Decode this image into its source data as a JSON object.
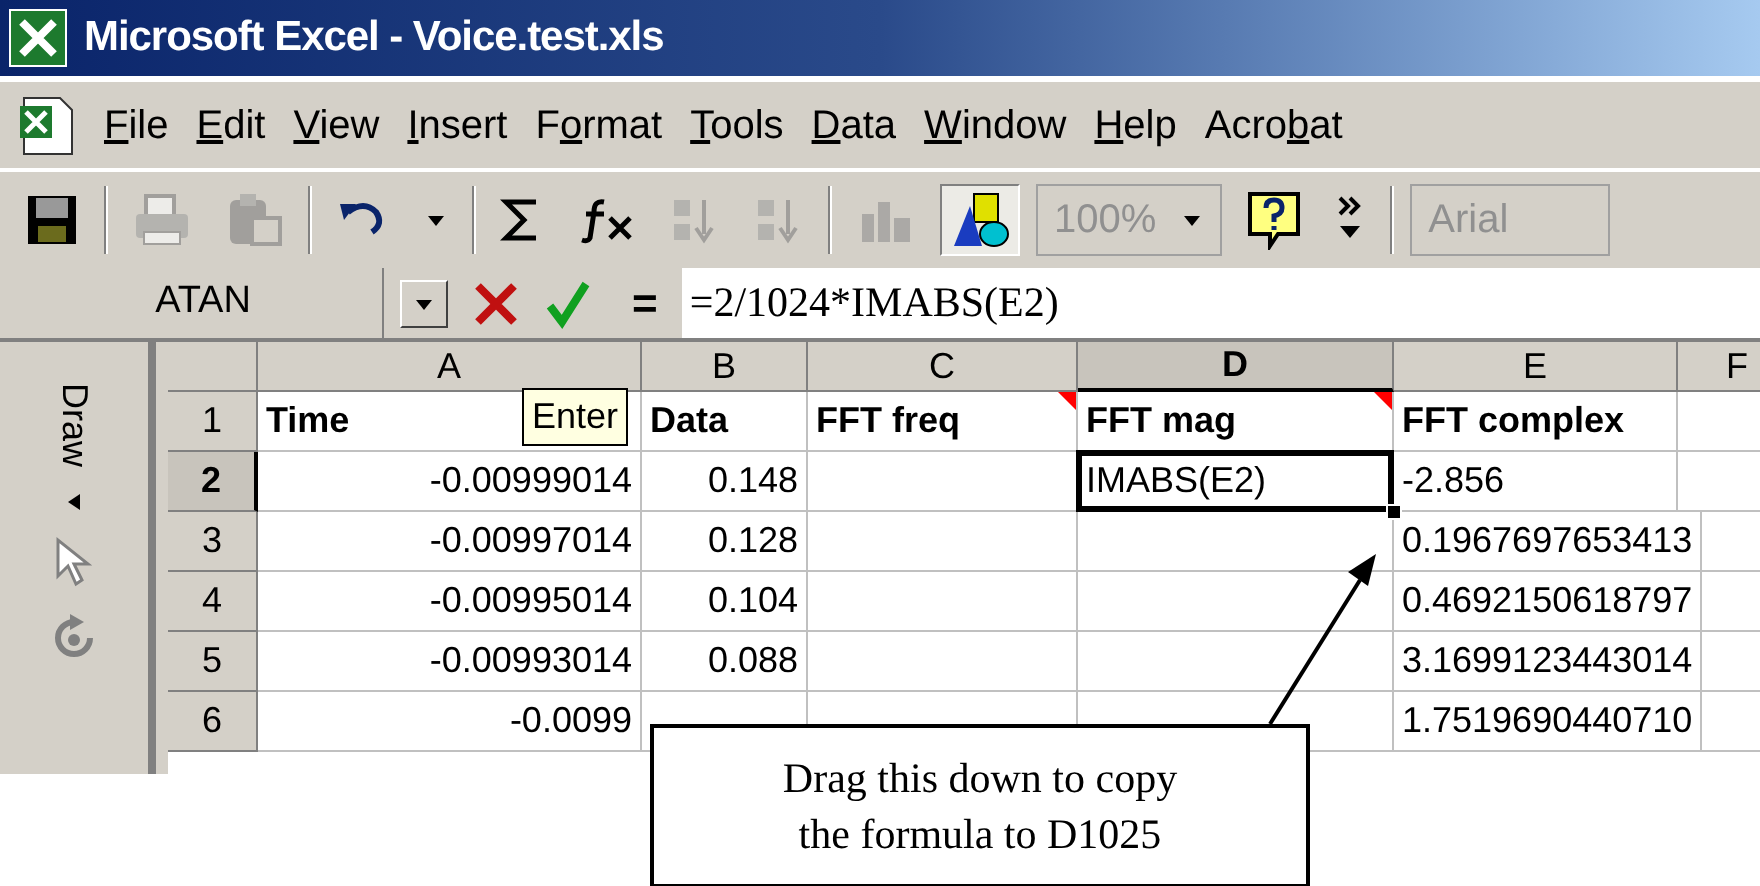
{
  "window": {
    "title": "Microsoft Excel - Voice.test.xls"
  },
  "menu_bar": {
    "items": [
      {
        "key": "F",
        "rest": "ile"
      },
      {
        "key": "E",
        "rest": "dit"
      },
      {
        "key": "V",
        "rest": "iew"
      },
      {
        "key": "I",
        "rest": "nsert"
      },
      {
        "pre": "F",
        "key": "o",
        "rest": "rmat"
      },
      {
        "key": "T",
        "rest": "ools"
      },
      {
        "key": "D",
        "rest": "ata"
      },
      {
        "key": "W",
        "rest": "indow"
      },
      {
        "key": "H",
        "rest": "elp"
      },
      {
        "pre": "Acro",
        "key": "b",
        "rest": "at"
      }
    ]
  },
  "toolbar": {
    "groups": [
      [
        {
          "kind": "save",
          "disabled": false
        }
      ],
      [
        {
          "kind": "print",
          "disabled": true
        },
        {
          "kind": "paste",
          "disabled": true
        }
      ],
      [
        {
          "kind": "undo",
          "disabled": false
        },
        {
          "kind": "dropdown",
          "disabled": false
        }
      ],
      [
        {
          "kind": "sum",
          "disabled": false
        },
        {
          "kind": "function",
          "disabled": false
        },
        {
          "kind": "sortup",
          "disabled": true
        },
        {
          "kind": "sortdown",
          "disabled": true
        }
      ],
      [
        {
          "kind": "chart",
          "disabled": true
        },
        {
          "kind": "drawing",
          "disabled": false,
          "pressed": true
        },
        {
          "kind": "zoom",
          "value": "100%",
          "disabled": true
        },
        {
          "kind": "help",
          "disabled": false
        },
        {
          "kind": "more",
          "disabled": false
        }
      ],
      [
        {
          "kind": "font",
          "value": "Arial",
          "disabled": true
        }
      ]
    ]
  },
  "formula_bar": {
    "name_box": "ATAN",
    "equals_label": "=",
    "formula": "=2/1024*IMABS(E2)"
  },
  "draw_toolbar": {
    "title": "Draw"
  },
  "sheet": {
    "columns": [
      {
        "label": "A",
        "selected": false
      },
      {
        "label": "B",
        "selected": false
      },
      {
        "label": "C",
        "selected": false
      },
      {
        "label": "D",
        "selected": true
      },
      {
        "label": "E",
        "selected": false
      },
      {
        "label": "F",
        "selected": false
      }
    ],
    "rows": [
      {
        "label": "1",
        "selected": false,
        "bold": true,
        "cells": [
          {
            "text": "Time"
          },
          {
            "text": "Data"
          },
          {
            "text": "FFT freq",
            "comment": true
          },
          {
            "text": "FFT mag",
            "comment": true
          },
          {
            "text": "FFT complex"
          },
          {}
        ]
      },
      {
        "label": "2",
        "selected": true,
        "bold": false,
        "cells": [
          {
            "text": "-0.00999014",
            "kind": "number"
          },
          {
            "text": "0.148",
            "kind": "number"
          },
          {},
          {
            "text": "IMABS(E2)",
            "selected": true
          },
          {
            "text": "-2.856"
          },
          {}
        ]
      },
      {
        "label": "3",
        "selected": false,
        "bold": false,
        "cells": [
          {
            "text": "-0.00997014",
            "kind": "number"
          },
          {
            "text": "0.128",
            "kind": "number"
          },
          {},
          {},
          {
            "text": "0.1967697653413"
          },
          {}
        ]
      },
      {
        "label": "4",
        "selected": false,
        "bold": false,
        "cells": [
          {
            "text": "-0.00995014",
            "kind": "number"
          },
          {
            "text": "0.104",
            "kind": "number"
          },
          {},
          {},
          {
            "text": "0.4692150618797"
          },
          {}
        ]
      },
      {
        "label": "5",
        "selected": false,
        "bold": false,
        "cells": [
          {
            "text": "-0.00993014",
            "kind": "number"
          },
          {
            "text": "0.088",
            "kind": "number"
          },
          {},
          {},
          {
            "text": "3.1699123443014"
          },
          {}
        ]
      },
      {
        "label": "6",
        "selected": false,
        "bold": false,
        "cells": [
          {
            "text": "-0.0099",
            "kind": "number"
          },
          {},
          {},
          {},
          {
            "text": "1.7519690440710"
          },
          {}
        ]
      }
    ]
  },
  "tooltip": {
    "text": "Enter"
  },
  "callout": {
    "lines": [
      "Drag this down to copy",
      "the formula to D1025"
    ]
  }
}
